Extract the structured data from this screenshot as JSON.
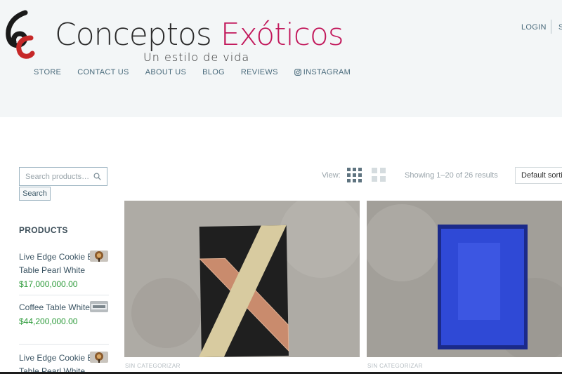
{
  "header": {
    "brand_part1": "Conceptos ",
    "brand_part2": "Exóticos",
    "tagline": "Un estilo de vida",
    "login": "LOGIN",
    "login_extra": "S",
    "nav": [
      {
        "label": "STORE"
      },
      {
        "label": "CONTACT US"
      },
      {
        "label": "ABOUT US"
      },
      {
        "label": "BLOG"
      },
      {
        "label": "REVIEWS"
      },
      {
        "label": "INSTAGRAM",
        "icon": "instagram-icon"
      }
    ],
    "colors": {
      "brand_accent": "#c2185b",
      "nav_text": "#4a6b7c",
      "header_bg": "#f3f6f7"
    }
  },
  "sidebar": {
    "search_placeholder": "Search products…",
    "search_button": "Search",
    "products_title": "PRODUCTS",
    "products": [
      {
        "name": "Live Edge Cookie End Table Pearl White",
        "price": "$17,000,000.00"
      },
      {
        "name": "Coffee Table White",
        "price": "$44,200,000.00"
      },
      {
        "name": "Live Edge Cookie End Table Pearl White",
        "price": ""
      }
    ],
    "price_color": "#2e9b3b"
  },
  "toolbar": {
    "view_label": "View:",
    "showing": "Showing 1–20 of 26 results",
    "sort_selected": "Default sorting"
  },
  "grid": {
    "products": [
      {
        "category": "SIN CATEGORIZAR"
      },
      {
        "category": "SIN CATEGORIZAR"
      }
    ]
  }
}
